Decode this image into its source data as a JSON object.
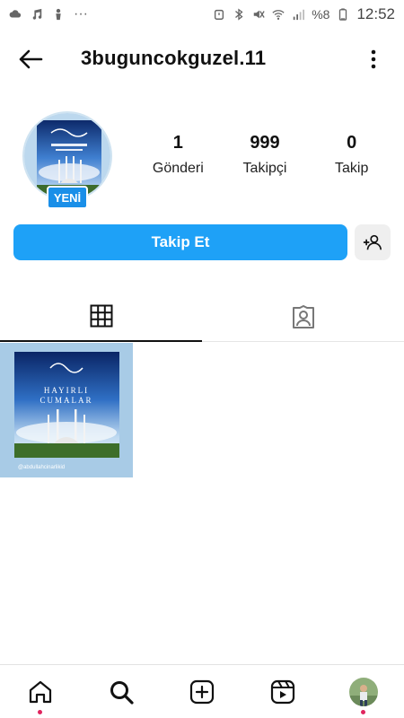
{
  "statusbar": {
    "battery": "%8",
    "time": "12:52",
    "more": "···"
  },
  "header": {
    "username": "3buguncokguzel.11"
  },
  "profile": {
    "new_badge": "YENİ",
    "stats": [
      {
        "value": "1",
        "label": "Gönderi"
      },
      {
        "value": "999",
        "label": "Takipçi"
      },
      {
        "value": "0",
        "label": "Takip"
      }
    ]
  },
  "actions": {
    "follow_label": "Takip Et"
  },
  "post": {
    "caption_top": "HAYIRLI",
    "caption_bottom": "CUMALAR",
    "watermark": "@abdullahcinarlikid"
  },
  "icons": {
    "back": "arrow-left-icon",
    "more": "vertical-dots-icon",
    "add_user": "add-user-icon",
    "grid": "grid-icon",
    "tagged": "tagged-person-icon",
    "home": "home-icon",
    "search": "search-icon",
    "create": "plus-square-icon",
    "reels": "reels-icon"
  },
  "colors": {
    "accent": "#1ea1f7",
    "badge": "#1a8fe8",
    "notification_dot": "#e0245e"
  }
}
